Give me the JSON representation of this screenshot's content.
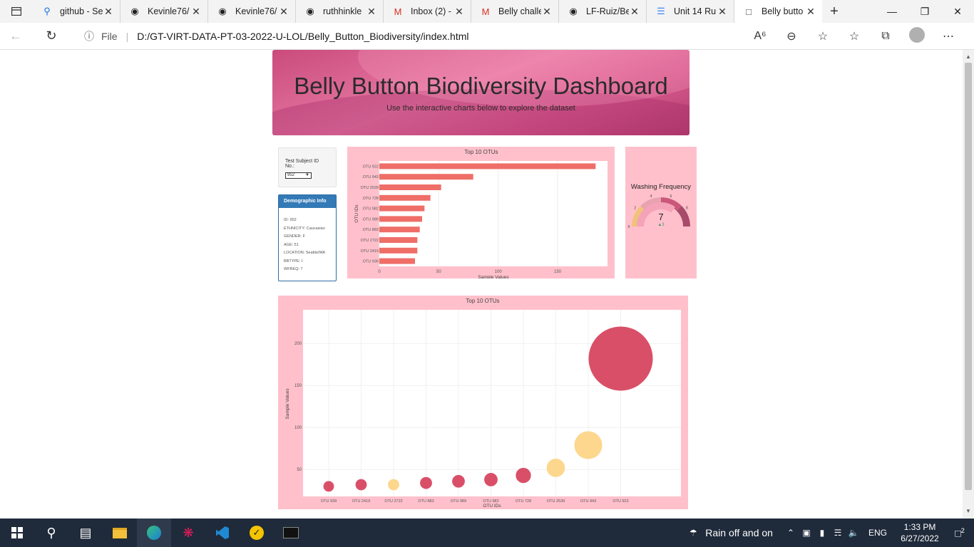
{
  "browser": {
    "tabs": [
      {
        "title": "github - Se",
        "icon": "search-icon"
      },
      {
        "title": "Kevinle76/",
        "icon": "github-icon"
      },
      {
        "title": "Kevinle76/",
        "icon": "github-icon"
      },
      {
        "title": "ruthhinkle",
        "icon": "github-icon"
      },
      {
        "title": "Inbox (2) -",
        "icon": "gmail-icon"
      },
      {
        "title": "Belly challe",
        "icon": "gmail-icon"
      },
      {
        "title": "LF-Ruiz/Be",
        "icon": "github-icon"
      },
      {
        "title": "Unit 14 Ru",
        "icon": "docs-icon"
      },
      {
        "title": "Belly butto",
        "icon": "page-icon",
        "active": true
      }
    ],
    "address": {
      "scheme_label": "File",
      "url": "D:/GT-VIRT-DATA-PT-03-2022-U-LOL/Belly_Button_Biodiversity/index.html"
    }
  },
  "page": {
    "title": "Belly Button Biodiversity Dashboard",
    "subtitle": "Use the interactive charts below to explore the dataset",
    "selector": {
      "label": "Test Subject ID No.:",
      "value": "952"
    },
    "demographic": {
      "heading": "Demographic Info",
      "rows": [
        "ID: 952",
        "ETHNICITY: Caucasian",
        "GENDER: F",
        "AGE: 51",
        "LOCATION: Seattle/WA",
        "BBTYPE: I",
        "WFREQ: 7"
      ]
    }
  },
  "chart_data": [
    {
      "type": "bar",
      "orientation": "horizontal",
      "title": "Top 10 OTUs",
      "xlabel": "Sample Values",
      "ylabel": "OTU IDs",
      "categories": [
        "OTU 922",
        "OTU 943",
        "OTU 2539",
        "OTU 728",
        "OTU 982",
        "OTU 989",
        "OTU 883",
        "OTU 2722",
        "OTU 2419",
        "OTU 939"
      ],
      "category_labels": [
        "OTU 922",
        "OTU 943",
        "OTU 2539",
        "OTU 728",
        "OTU 982",
        "OTU 989",
        "OTU 883",
        "OTU 2722",
        "OTU 2419",
        "OTU 939"
      ],
      "values": [
        182,
        79,
        52,
        43,
        38,
        36,
        34,
        32,
        32,
        30
      ],
      "xticks": [
        0,
        50,
        100,
        150
      ],
      "xlim": [
        0,
        192
      ],
      "color": "#ef6e68"
    },
    {
      "type": "gauge",
      "title": "Washing Frequency",
      "value": 7,
      "range": [
        0,
        10
      ],
      "delta": "3",
      "ticks": [
        "0",
        "2",
        "4",
        "6",
        "8"
      ],
      "colors": [
        "#f0c27b",
        "#e8a2b0",
        "#c9587a",
        "#a84a6a"
      ]
    },
    {
      "type": "scatter",
      "subtype": "bubble",
      "title": "Top 10 OTUs",
      "xlabel": "OTU IDs",
      "ylabel": "Sample Values",
      "categories": [
        "OTU 939",
        "OTU 2419",
        "OTU 2722",
        "OTU 883",
        "OTU 989",
        "OTU 982",
        "OTU 728",
        "OTU 2539",
        "OTU 943",
        "OTU 922"
      ],
      "values": [
        30,
        32,
        32,
        34,
        36,
        38,
        43,
        52,
        79,
        182
      ],
      "colors": [
        "#d6405a",
        "#d6405a",
        "#fcd483",
        "#d6405a",
        "#d6405a",
        "#d6405a",
        "#d6405a",
        "#fcd483",
        "#fcd483",
        "#d6405a"
      ],
      "yticks": [
        50,
        100,
        150,
        200
      ],
      "ylim": [
        18,
        240
      ]
    }
  ],
  "taskbar": {
    "weather": "Rain off and on",
    "language": "ENG",
    "time": "1:33 PM",
    "date": "6/27/2022",
    "notifications": "2"
  }
}
